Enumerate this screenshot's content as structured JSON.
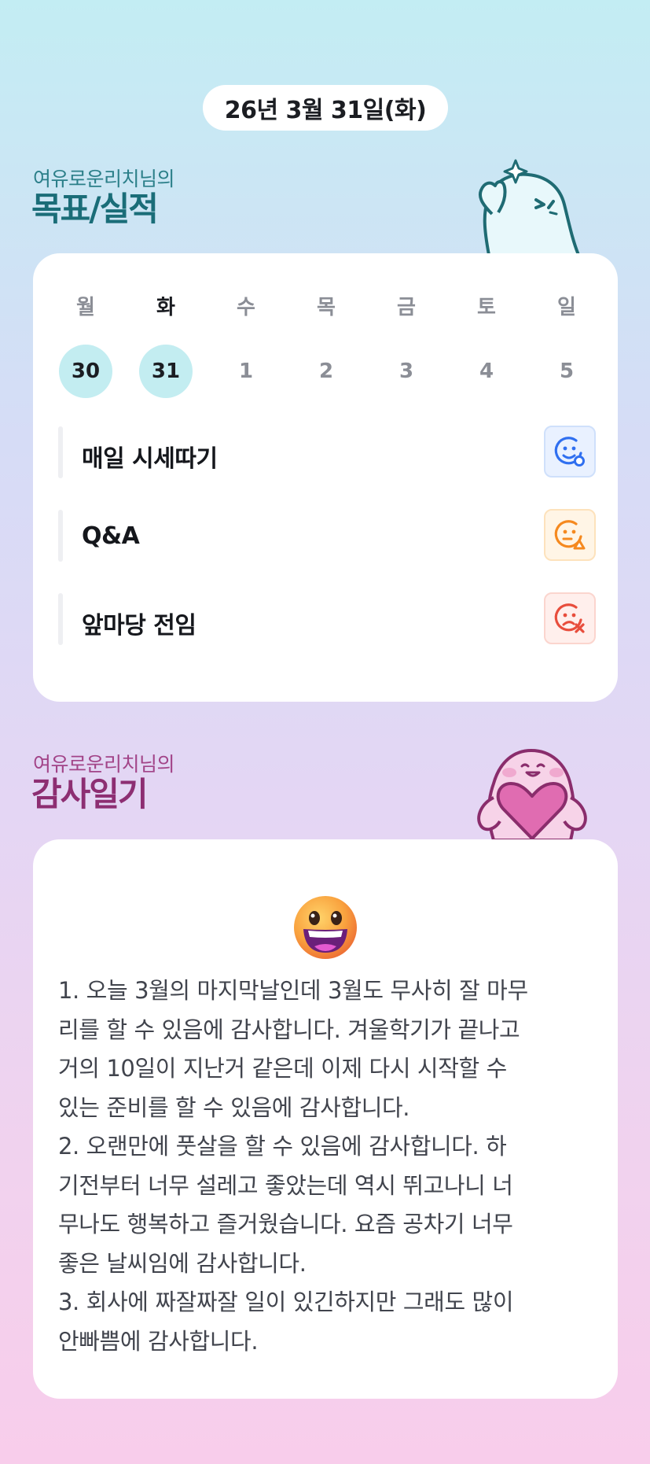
{
  "header": {
    "date": "26년 3월 31일(화)"
  },
  "goals": {
    "subtitle": "여유로운리치님의",
    "title": "목표/실적",
    "week": [
      {
        "name": "월",
        "num": "30",
        "done": true
      },
      {
        "name": "화",
        "num": "31",
        "done": true,
        "today": true
      },
      {
        "name": "수",
        "num": "1"
      },
      {
        "name": "목",
        "num": "2"
      },
      {
        "name": "금",
        "num": "3"
      },
      {
        "name": "토",
        "num": "4"
      },
      {
        "name": "일",
        "num": "5"
      }
    ],
    "items": [
      {
        "label": "매일 시세따기",
        "status_icon": "smile-check-icon",
        "color": "#2f6ff0"
      },
      {
        "label": "Q&A",
        "status_icon": "neutral-triangle-icon",
        "color": "#f5891f"
      },
      {
        "label": "앞마당 전임",
        "status_icon": "sad-x-icon",
        "color": "#e84d3c"
      }
    ]
  },
  "gratitude": {
    "subtitle": "여유로운리치님의",
    "title": "감사일기",
    "emoji_icon": "grinning-face-icon",
    "lines": [
      "1. 오늘 3월의 마지막날인데 3월도 무사히 잘 마무",
      "리를 할 수 있음에 감사합니다. 겨울학기가 끝나고",
      "거의 10일이 지난거 같은데 이제 다시 시작할 수",
      "있는 준비를 할 수 있음에 감사합니다.",
      "2. 오랜만에 풋살을 할 수 있음에 감사합니다. 하",
      "기전부터 너무 설레고 좋았는데 역시 뛰고나니 너",
      "무나도 행복하고 즐거웠습니다. 요즘 공차기 너무",
      "좋은 날씨임에 감사합니다.",
      "3. 회사에 짜잘짜잘 일이 있긴하지만 그래도 많이",
      "안빠쁨에 감사합니다."
    ]
  }
}
